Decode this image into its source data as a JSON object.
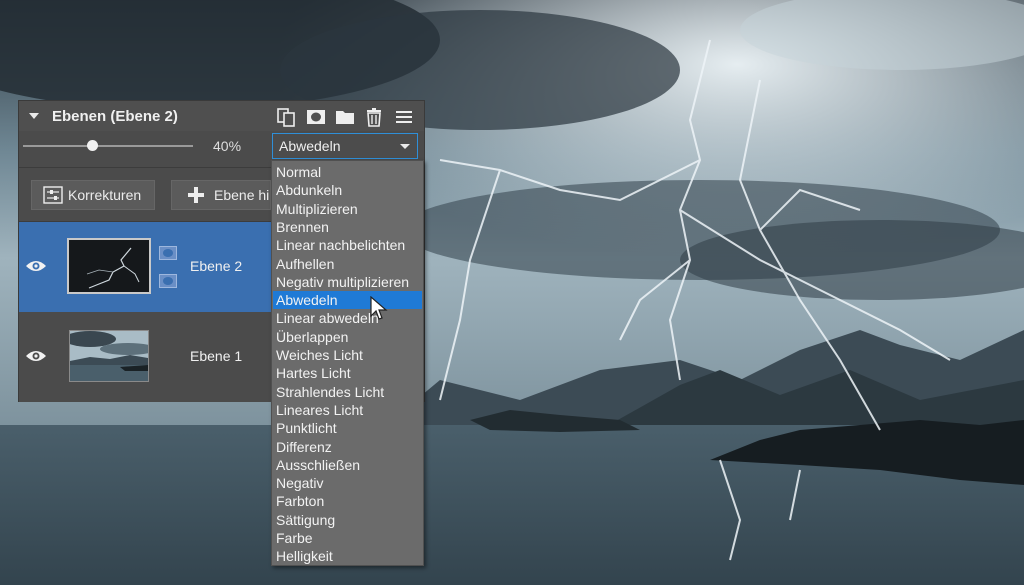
{
  "panel": {
    "title": "Ebenen (Ebene 2)",
    "header_icons": [
      "duplicate-layer-icon",
      "add-mask-icon",
      "folder-icon",
      "trash-icon",
      "menu-icon"
    ]
  },
  "opacity": {
    "value_label": "40%",
    "value": 0.4
  },
  "blend_mode": {
    "selected": "Abwedeln",
    "options": [
      "Normal",
      "Abdunkeln",
      "Multiplizieren",
      "Brennen",
      "Linear nachbelichten",
      "Aufhellen",
      "Negativ multiplizieren",
      "Abwedeln",
      "Linear abwedeln",
      "Überlappen",
      "Weiches Licht",
      "Hartes Licht",
      "Strahlendes Licht",
      "Lineares Licht",
      "Punktlicht",
      "Differenz",
      "Ausschließen",
      "Negativ",
      "Farbton",
      "Sättigung",
      "Farbe",
      "Helligkeit"
    ]
  },
  "buttons": {
    "adjustments": "Korrekturen",
    "add_layer": "Ebene hi"
  },
  "layers": [
    {
      "name": "Ebene 2",
      "selected": true,
      "visible": true
    },
    {
      "name": "Ebene 1",
      "selected": false,
      "visible": true
    }
  ],
  "colors": {
    "selection": "#3a6fb0",
    "dropdown_highlight": "#1f7ad6",
    "panel_bg": "#4b4b4b"
  }
}
